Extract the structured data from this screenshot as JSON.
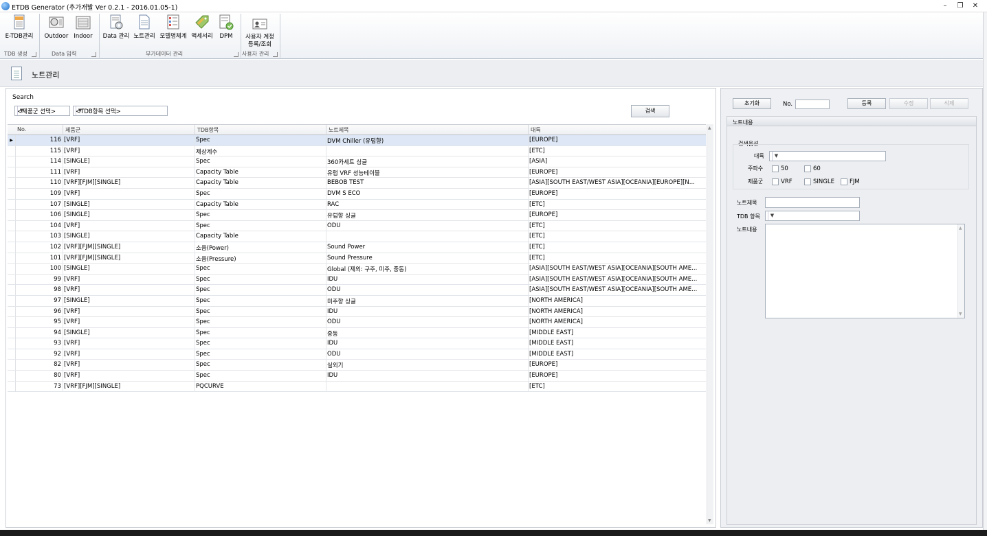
{
  "window": {
    "title": "ETDB Generator (추가개발 Ver 0.2.1 - 2016.01.05-1)",
    "controls": [
      "minimize-icon",
      "restore-icon",
      "close-icon"
    ]
  },
  "ribbon": {
    "buttons": {
      "etdb": "E-TDB관리",
      "outdoor": "Outdoor",
      "indoor": "Indoor",
      "data_mgmt": "Data 관리",
      "note_mgmt": "노트관리",
      "model_system": "모델명체계",
      "accessory": "액세서리",
      "dpm": "DPM",
      "user_reg_1": "사용자 계정",
      "user_reg_2": "등록/조회"
    },
    "groups": {
      "tdb_create": "TDB 생성",
      "data_input": "Data 입력",
      "extra_data": "부가데이터 관리",
      "user_mgmt": "사용자 관리"
    }
  },
  "page": {
    "title": "노트관리"
  },
  "search": {
    "label": "Search",
    "product_group": "<제품군 선택>",
    "tdb_item": "<TDB항목 선택>",
    "search_button": "검색"
  },
  "grid": {
    "columns": {
      "no": "No.",
      "group": "제품군",
      "tdb": "TDB항목",
      "title": "노트제목",
      "region": "대륙"
    },
    "rows": [
      {
        "no": "116",
        "group": "[VRF]",
        "tdb": "Spec",
        "title": "DVM Chiller (유럽향)",
        "region": "[EUROPE]"
      },
      {
        "no": "115",
        "group": "[VRF]",
        "tdb": "제상계수",
        "title": "",
        "region": "[ETC]"
      },
      {
        "no": "114",
        "group": "[SINGLE]",
        "tdb": "Spec",
        "title": "360카세트 싱글",
        "region": "[ASIA]"
      },
      {
        "no": "111",
        "group": "[VRF]",
        "tdb": "Capacity Table",
        "title": "유럽 VRF 성능테이블",
        "region": "[EUROPE]"
      },
      {
        "no": "110",
        "group": "[VRF][FJM][SINGLE]",
        "tdb": "Capacity Table",
        "title": "BEBOB TEST",
        "region": "[ASIA][SOUTH EAST/WEST ASIA][OCEANIA][EUROPE][N..."
      },
      {
        "no": "109",
        "group": "[VRF]",
        "tdb": "Spec",
        "title": "DVM S ECO",
        "region": "[EUROPE]"
      },
      {
        "no": "107",
        "group": "[SINGLE]",
        "tdb": "Capacity Table",
        "title": "RAC",
        "region": "[ETC]"
      },
      {
        "no": "106",
        "group": "[SINGLE]",
        "tdb": "Spec",
        "title": "유럽향 싱글",
        "region": "[EUROPE]"
      },
      {
        "no": "104",
        "group": "[VRF]",
        "tdb": "Spec",
        "title": "ODU",
        "region": "[ETC]"
      },
      {
        "no": "103",
        "group": "[SINGLE]",
        "tdb": "Capacity Table",
        "title": "",
        "region": "[ETC]"
      },
      {
        "no": "102",
        "group": "[VRF][FJM][SINGLE]",
        "tdb": "소음(Power)",
        "title": "Sound Power",
        "region": "[ETC]"
      },
      {
        "no": "101",
        "group": "[VRF][FJM][SINGLE]",
        "tdb": "소음(Pressure)",
        "title": "Sound Pressure",
        "region": "[ETC]"
      },
      {
        "no": "100",
        "group": "[SINGLE]",
        "tdb": "Spec",
        "title": "Global (제외: 구주, 미주, 중동)",
        "region": "[ASIA][SOUTH EAST/WEST ASIA][OCEANIA][SOUTH AME..."
      },
      {
        "no": "99",
        "group": "[VRF]",
        "tdb": "Spec",
        "title": "IDU",
        "region": "[ASIA][SOUTH EAST/WEST ASIA][OCEANIA][SOUTH AME..."
      },
      {
        "no": "98",
        "group": "[VRF]",
        "tdb": "Spec",
        "title": "ODU",
        "region": "[ASIA][SOUTH EAST/WEST ASIA][OCEANIA][SOUTH AME..."
      },
      {
        "no": "97",
        "group": "[SINGLE]",
        "tdb": "Spec",
        "title": "미주향 싱글",
        "region": "[NORTH AMERICA]"
      },
      {
        "no": "96",
        "group": "[VRF]",
        "tdb": "Spec",
        "title": "IDU",
        "region": "[NORTH AMERICA]"
      },
      {
        "no": "95",
        "group": "[VRF]",
        "tdb": "Spec",
        "title": "ODU",
        "region": "[NORTH AMERICA]"
      },
      {
        "no": "94",
        "group": "[SINGLE]",
        "tdb": "Spec",
        "title": "중동",
        "region": "[MIDDLE EAST]"
      },
      {
        "no": "93",
        "group": "[VRF]",
        "tdb": "Spec",
        "title": "IDU",
        "region": "[MIDDLE EAST]"
      },
      {
        "no": "92",
        "group": "[VRF]",
        "tdb": "Spec",
        "title": "ODU",
        "region": "[MIDDLE EAST]"
      },
      {
        "no": "82",
        "group": "[VRF]",
        "tdb": "Spec",
        "title": "실외기",
        "region": "[EUROPE]"
      },
      {
        "no": "80",
        "group": "[VRF]",
        "tdb": "Spec",
        "title": "IDU",
        "region": "[EUROPE]"
      },
      {
        "no": "73",
        "group": "[VRF][FJM][SINGLE]",
        "tdb": "PQCURVE",
        "title": "",
        "region": "[ETC]"
      }
    ]
  },
  "editor": {
    "reset_button": "초기화",
    "no_label": "No.",
    "no_value": "",
    "register_button": "등록",
    "modify_button": "수정",
    "delete_button": "삭제",
    "section_title": "노트내용",
    "search_options_title": "검색옵션",
    "region_label": "대륙",
    "region_value": "",
    "frequency_label": "주파수",
    "freq_50": "50",
    "freq_60": "60",
    "group_label": "제품군",
    "group_vrf": "VRF",
    "group_single": "SINGLE",
    "group_fjm": "FJM",
    "note_title_label": "노트제목",
    "note_title_value": "",
    "tdb_item_label": "TDB 항목",
    "tdb_item_value": "",
    "note_content_label": "노트내용",
    "note_content_value": ""
  }
}
